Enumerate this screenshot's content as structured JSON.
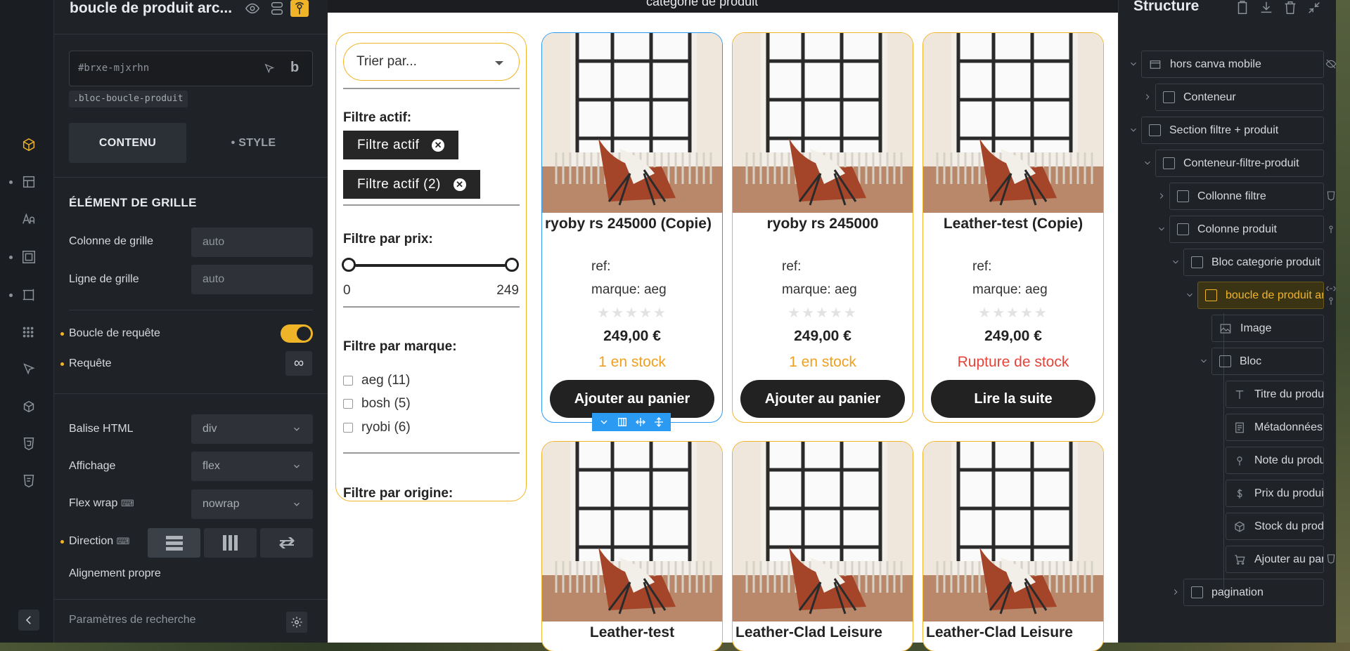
{
  "panel": {
    "title": "boucle de produit arc...",
    "element_id": "#brxe-mjxrhn",
    "class_tag": ".bloc-boucle-produit",
    "tab_content": "CONTENU",
    "tab_style": "• STYLE",
    "section_title": "ÉLÉMENT DE GRILLE",
    "grid_column_label": "Colonne de grille",
    "grid_column_value": "auto",
    "grid_row_label": "Ligne de grille",
    "grid_row_value": "auto",
    "query_loop_label": "Boucle de requête",
    "query_label": "Requête",
    "html_tag_label": "Balise HTML",
    "html_tag_value": "div",
    "display_label": "Affichage",
    "display_value": "flex",
    "flex_wrap_label": "Flex wrap",
    "flex_wrap_value": "nowrap",
    "direction_label": "Direction",
    "align_self_label": "Alignement propre",
    "search_settings": "Paramètres de recherche"
  },
  "canvas": {
    "top_label": "catégorie de produit",
    "filters": {
      "sort_placeholder": "Trier par...",
      "active_title": "Filtre actif:",
      "chips": [
        "Filtre actif",
        "Filtre actif (2)"
      ],
      "price_title": "Filtre par prix:",
      "price_min": "0",
      "price_max": "249",
      "brand_title": "Filtre par marque:",
      "brands": [
        "aeg (11)",
        "bosh (5)",
        "ryobi (6)"
      ],
      "origin_title": "Filtre par origine:"
    },
    "products": [
      {
        "title": "ryoby rs 245000 (Copie)",
        "ref": "ref:",
        "brand": "marque: aeg",
        "price": "249,00 €",
        "stock": "1 en stock",
        "button": "Ajouter au panier"
      },
      {
        "title": "ryoby rs 245000",
        "ref": "ref:",
        "brand": "marque: aeg",
        "price": "249,00 €",
        "stock": "1 en stock",
        "button": "Ajouter au panier"
      },
      {
        "title": "Leather-test (Copie)",
        "ref": "ref:",
        "brand": "marque: aeg",
        "price": "249,00 €",
        "stock": "Rupture de stock",
        "button": "Lire la suite"
      },
      {
        "title": "Leather-test"
      },
      {
        "title": "Leather-Clad Leisure"
      },
      {
        "title": "Leather-Clad Leisure"
      }
    ],
    "colors": {
      "accent": "#f0b429",
      "selected": "#2b9af3",
      "in_stock": "#f0a020",
      "out_of_stock": "#e8433a"
    }
  },
  "structure": {
    "title": "Structure",
    "nodes": [
      "hors canva mobile",
      "Conteneur",
      "Section filtre + produit",
      "Conteneur-filtre-produit",
      "Collonne filtre",
      "Colonne produit",
      "Bloc categorie produit",
      "boucle de produit archive",
      "Image",
      "Bloc",
      "Titre du produit",
      "Métadonnées",
      "Note du produit",
      "Prix du produit",
      "Stock du produit",
      "Ajouter au panier",
      "pagination"
    ]
  }
}
